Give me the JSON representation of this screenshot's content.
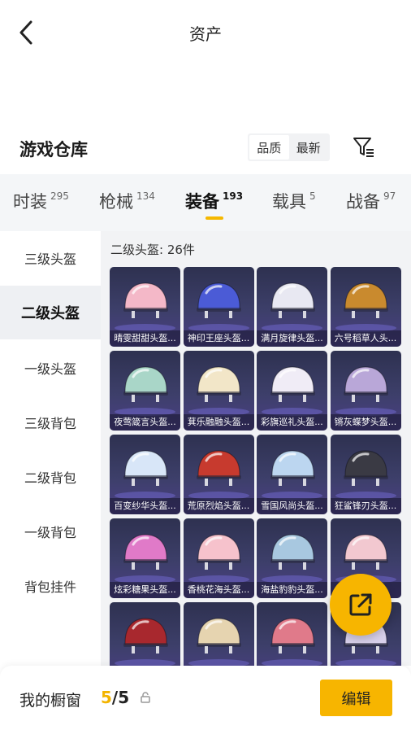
{
  "header": {
    "title": "资产"
  },
  "section": {
    "title": "游戏仓库",
    "sort_options": [
      "品质",
      "最新"
    ],
    "active_sort": "品质"
  },
  "category_tabs": [
    {
      "label": "时装",
      "count": "295"
    },
    {
      "label": "枪械",
      "count": "134"
    },
    {
      "label": "装备",
      "count": "193",
      "active": true
    },
    {
      "label": "载具",
      "count": "5"
    },
    {
      "label": "战备",
      "count": "97"
    }
  ],
  "sidebar": {
    "items": [
      {
        "label": "三级头盔"
      },
      {
        "label": "二级头盔",
        "active": true
      },
      {
        "label": "一级头盔"
      },
      {
        "label": "三级背包"
      },
      {
        "label": "二级背包"
      },
      {
        "label": "一级背包"
      },
      {
        "label": "背包挂件"
      }
    ]
  },
  "content": {
    "header": "二级头盔: 26件",
    "items": [
      {
        "name": "晴雯甜甜头盔...",
        "color": "#f4b8c8"
      },
      {
        "name": "神印王座头盔...",
        "color": "#4b5bd6"
      },
      {
        "name": "满月旋律头盔...",
        "color": "#e8e8f2"
      },
      {
        "name": "六号稻草人头...",
        "color": "#c98a2e"
      },
      {
        "name": "夜莺箴言头盔...",
        "color": "#a9d6c8"
      },
      {
        "name": "萁乐融融头盔...",
        "color": "#f2e6c8"
      },
      {
        "name": "彩旗巡礼头盔...",
        "color": "#f0ecf6"
      },
      {
        "name": "锵灰蝶梦头盔...",
        "color": "#b9a7d8"
      },
      {
        "name": "百变纱华头盔...",
        "color": "#d8e6f8"
      },
      {
        "name": "荒原烈焰头盔...",
        "color": "#c73a2e"
      },
      {
        "name": "雪国风尚头盔...",
        "color": "#bcd6f0"
      },
      {
        "name": "狂鲨锋刃头盔...",
        "color": "#3a3a44"
      },
      {
        "name": "炫彩糖果头盔...",
        "color": "#e07ac8"
      },
      {
        "name": "香桃花海头盔...",
        "color": "#f6c2cc"
      },
      {
        "name": "海盐豹豹头盔...",
        "color": "#a8c8e0"
      },
      {
        "name": "...",
        "color": "#f2c8d0"
      },
      {
        "name": "",
        "color": "#a8282e"
      },
      {
        "name": "",
        "color": "#e6d4b0"
      },
      {
        "name": "",
        "color": "#e07a8a"
      },
      {
        "name": "",
        "color": "#d8d0ea"
      }
    ]
  },
  "bottom": {
    "showcase_label": "我的橱窗",
    "showcase_current": "5",
    "showcase_total": "/5",
    "edit_label": "编辑"
  },
  "colors": {
    "accent": "#f7b500"
  }
}
